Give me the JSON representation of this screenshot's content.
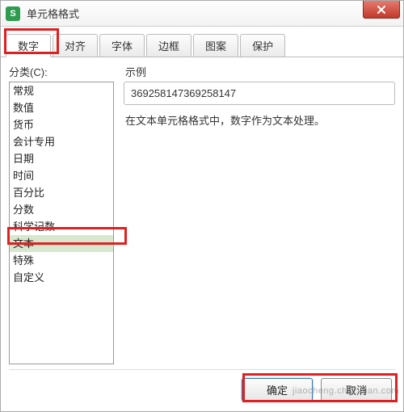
{
  "window": {
    "title": "单元格格式",
    "icon_letter": "S"
  },
  "tabs": [
    {
      "label": "数字",
      "active": true
    },
    {
      "label": "对齐",
      "active": false
    },
    {
      "label": "字体",
      "active": false
    },
    {
      "label": "边框",
      "active": false
    },
    {
      "label": "图案",
      "active": false
    },
    {
      "label": "保护",
      "active": false
    }
  ],
  "category": {
    "label": "分类(C):",
    "items": [
      {
        "label": "常规",
        "selected": false
      },
      {
        "label": "数值",
        "selected": false
      },
      {
        "label": "货币",
        "selected": false
      },
      {
        "label": "会计专用",
        "selected": false
      },
      {
        "label": "日期",
        "selected": false
      },
      {
        "label": "时间",
        "selected": false
      },
      {
        "label": "百分比",
        "selected": false
      },
      {
        "label": "分数",
        "selected": false
      },
      {
        "label": "科学记数",
        "selected": false
      },
      {
        "label": "文本",
        "selected": true
      },
      {
        "label": "特殊",
        "selected": false
      },
      {
        "label": "自定义",
        "selected": false
      }
    ]
  },
  "example": {
    "label": "示例",
    "value": "369258147369258147"
  },
  "description": "在文本单元格格式中，数字作为文本处理。",
  "buttons": {
    "ok": "确定",
    "cancel": "取消"
  },
  "watermark": "jiaocheng.chazidian.com"
}
